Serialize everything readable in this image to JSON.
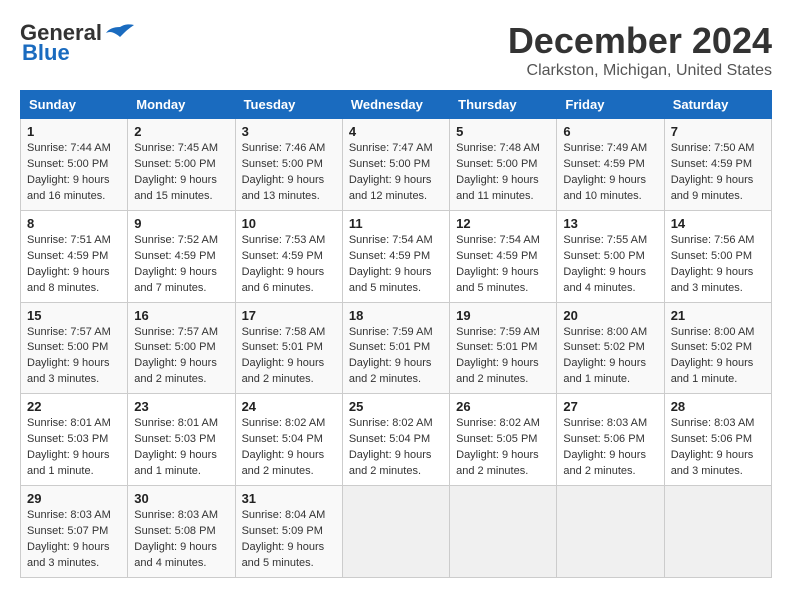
{
  "header": {
    "logo_line1": "General",
    "logo_line2": "Blue",
    "month": "December 2024",
    "location": "Clarkston, Michigan, United States"
  },
  "weekdays": [
    "Sunday",
    "Monday",
    "Tuesday",
    "Wednesday",
    "Thursday",
    "Friday",
    "Saturday"
  ],
  "weeks": [
    [
      {
        "day": "1",
        "info": "Sunrise: 7:44 AM\nSunset: 5:00 PM\nDaylight: 9 hours and 16 minutes."
      },
      {
        "day": "2",
        "info": "Sunrise: 7:45 AM\nSunset: 5:00 PM\nDaylight: 9 hours and 15 minutes."
      },
      {
        "day": "3",
        "info": "Sunrise: 7:46 AM\nSunset: 5:00 PM\nDaylight: 9 hours and 13 minutes."
      },
      {
        "day": "4",
        "info": "Sunrise: 7:47 AM\nSunset: 5:00 PM\nDaylight: 9 hours and 12 minutes."
      },
      {
        "day": "5",
        "info": "Sunrise: 7:48 AM\nSunset: 5:00 PM\nDaylight: 9 hours and 11 minutes."
      },
      {
        "day": "6",
        "info": "Sunrise: 7:49 AM\nSunset: 4:59 PM\nDaylight: 9 hours and 10 minutes."
      },
      {
        "day": "7",
        "info": "Sunrise: 7:50 AM\nSunset: 4:59 PM\nDaylight: 9 hours and 9 minutes."
      }
    ],
    [
      {
        "day": "8",
        "info": "Sunrise: 7:51 AM\nSunset: 4:59 PM\nDaylight: 9 hours and 8 minutes."
      },
      {
        "day": "9",
        "info": "Sunrise: 7:52 AM\nSunset: 4:59 PM\nDaylight: 9 hours and 7 minutes."
      },
      {
        "day": "10",
        "info": "Sunrise: 7:53 AM\nSunset: 4:59 PM\nDaylight: 9 hours and 6 minutes."
      },
      {
        "day": "11",
        "info": "Sunrise: 7:54 AM\nSunset: 4:59 PM\nDaylight: 9 hours and 5 minutes."
      },
      {
        "day": "12",
        "info": "Sunrise: 7:54 AM\nSunset: 4:59 PM\nDaylight: 9 hours and 5 minutes."
      },
      {
        "day": "13",
        "info": "Sunrise: 7:55 AM\nSunset: 5:00 PM\nDaylight: 9 hours and 4 minutes."
      },
      {
        "day": "14",
        "info": "Sunrise: 7:56 AM\nSunset: 5:00 PM\nDaylight: 9 hours and 3 minutes."
      }
    ],
    [
      {
        "day": "15",
        "info": "Sunrise: 7:57 AM\nSunset: 5:00 PM\nDaylight: 9 hours and 3 minutes."
      },
      {
        "day": "16",
        "info": "Sunrise: 7:57 AM\nSunset: 5:00 PM\nDaylight: 9 hours and 2 minutes."
      },
      {
        "day": "17",
        "info": "Sunrise: 7:58 AM\nSunset: 5:01 PM\nDaylight: 9 hours and 2 minutes."
      },
      {
        "day": "18",
        "info": "Sunrise: 7:59 AM\nSunset: 5:01 PM\nDaylight: 9 hours and 2 minutes."
      },
      {
        "day": "19",
        "info": "Sunrise: 7:59 AM\nSunset: 5:01 PM\nDaylight: 9 hours and 2 minutes."
      },
      {
        "day": "20",
        "info": "Sunrise: 8:00 AM\nSunset: 5:02 PM\nDaylight: 9 hours and 1 minute."
      },
      {
        "day": "21",
        "info": "Sunrise: 8:00 AM\nSunset: 5:02 PM\nDaylight: 9 hours and 1 minute."
      }
    ],
    [
      {
        "day": "22",
        "info": "Sunrise: 8:01 AM\nSunset: 5:03 PM\nDaylight: 9 hours and 1 minute."
      },
      {
        "day": "23",
        "info": "Sunrise: 8:01 AM\nSunset: 5:03 PM\nDaylight: 9 hours and 1 minute."
      },
      {
        "day": "24",
        "info": "Sunrise: 8:02 AM\nSunset: 5:04 PM\nDaylight: 9 hours and 2 minutes."
      },
      {
        "day": "25",
        "info": "Sunrise: 8:02 AM\nSunset: 5:04 PM\nDaylight: 9 hours and 2 minutes."
      },
      {
        "day": "26",
        "info": "Sunrise: 8:02 AM\nSunset: 5:05 PM\nDaylight: 9 hours and 2 minutes."
      },
      {
        "day": "27",
        "info": "Sunrise: 8:03 AM\nSunset: 5:06 PM\nDaylight: 9 hours and 2 minutes."
      },
      {
        "day": "28",
        "info": "Sunrise: 8:03 AM\nSunset: 5:06 PM\nDaylight: 9 hours and 3 minutes."
      }
    ],
    [
      {
        "day": "29",
        "info": "Sunrise: 8:03 AM\nSunset: 5:07 PM\nDaylight: 9 hours and 3 minutes."
      },
      {
        "day": "30",
        "info": "Sunrise: 8:03 AM\nSunset: 5:08 PM\nDaylight: 9 hours and 4 minutes."
      },
      {
        "day": "31",
        "info": "Sunrise: 8:04 AM\nSunset: 5:09 PM\nDaylight: 9 hours and 5 minutes."
      },
      null,
      null,
      null,
      null
    ]
  ]
}
